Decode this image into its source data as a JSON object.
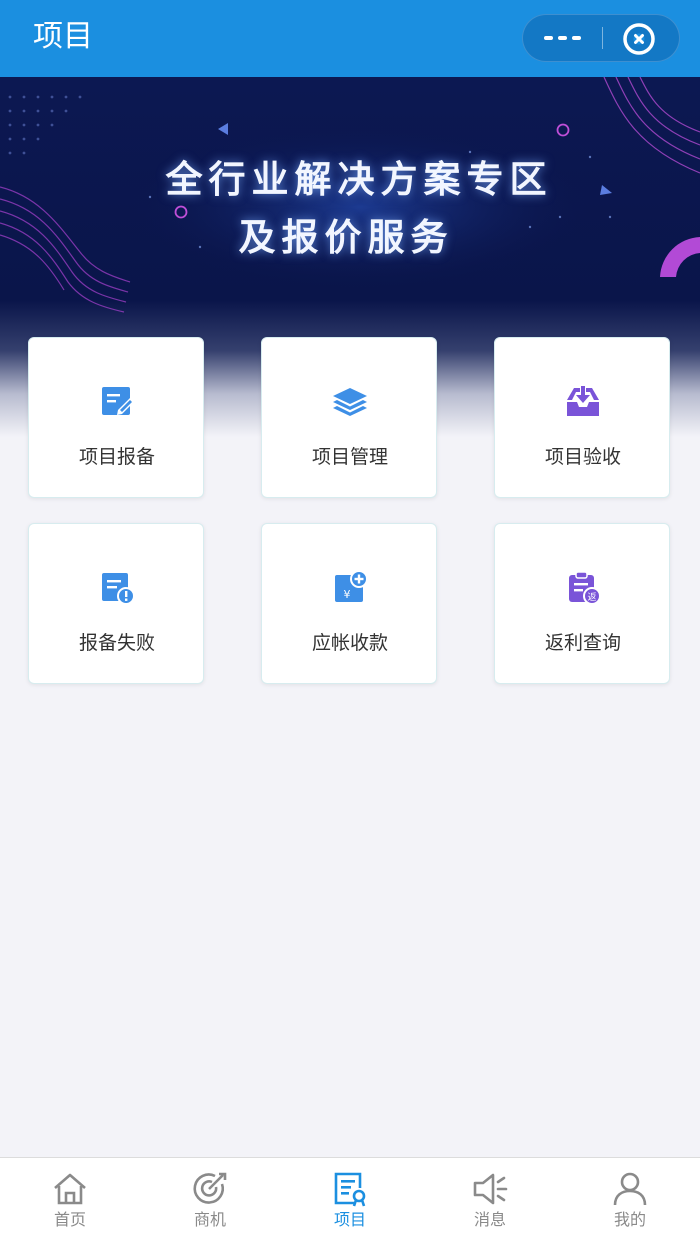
{
  "header": {
    "title": "项目"
  },
  "banner": {
    "line1": "全行业解决方案专区",
    "line2": "及报价服务"
  },
  "menu": [
    {
      "label": "项目报备",
      "icon": "edit-document-icon"
    },
    {
      "label": "项目管理",
      "icon": "layers-icon"
    },
    {
      "label": "项目验收",
      "icon": "inbox-download-icon"
    },
    {
      "label": "报备失败",
      "icon": "document-alert-icon"
    },
    {
      "label": "应帐收款",
      "icon": "yen-receipt-icon"
    },
    {
      "label": "返利查询",
      "icon": "rebate-clipboard-icon"
    }
  ],
  "tabs": [
    {
      "label": "首页",
      "icon": "home-icon"
    },
    {
      "label": "商机",
      "icon": "target-icon"
    },
    {
      "label": "项目",
      "icon": "project-document-icon",
      "active": true
    },
    {
      "label": "消息",
      "icon": "megaphone-icon"
    },
    {
      "label": "我的",
      "icon": "user-icon"
    }
  ],
  "colors": {
    "header": "#1b8fe0",
    "active_tab": "#1b8fe0",
    "blue_icon": "#3e8fe6",
    "purple_icon": "#7a54d8"
  }
}
